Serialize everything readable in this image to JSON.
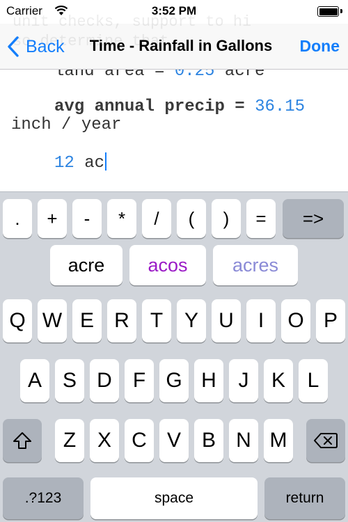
{
  "status_bar": {
    "carrier": "Carrier",
    "time": "3:52 PM",
    "wifi_icon": "wifi-icon",
    "battery_icon": "battery-icon"
  },
  "nav_bar": {
    "back_label": "Back",
    "title": "Time - Rainfall in Gallons",
    "done_label": "Done",
    "ghost_text": [
      "unit checks, support to hi",
      "so determine that..."
    ]
  },
  "editor": {
    "line1_prefix": "land area = ",
    "line1_value": "0.25",
    "line1_suffix": " acre",
    "line2_var": "avg annual precip",
    "line2_eq": " = ",
    "line2_value": "36.15",
    "line3": "inch / year",
    "line4_value": "12",
    "line4_suffix": " ac"
  },
  "keyboard": {
    "symbol_row": [
      ".",
      "+",
      "-",
      "*",
      "/",
      "(",
      ")",
      "=",
      "=>"
    ],
    "suggestions": [
      {
        "label": "acre",
        "color": "#000000"
      },
      {
        "label": "acos",
        "color": "#9b1bc6"
      },
      {
        "label": "acres",
        "color": "#8a8ad6"
      }
    ],
    "row1": [
      "Q",
      "W",
      "E",
      "R",
      "T",
      "Y",
      "U",
      "I",
      "O",
      "P"
    ],
    "row2": [
      "A",
      "S",
      "D",
      "F",
      "G",
      "H",
      "J",
      "K",
      "L"
    ],
    "row3": [
      "Z",
      "X",
      "C",
      "V",
      "B",
      "N",
      "M"
    ],
    "shift_icon": "shift-icon",
    "delete_icon": "delete-icon",
    "numbers_label": ".?123",
    "space_label": "space",
    "return_label": "return"
  }
}
